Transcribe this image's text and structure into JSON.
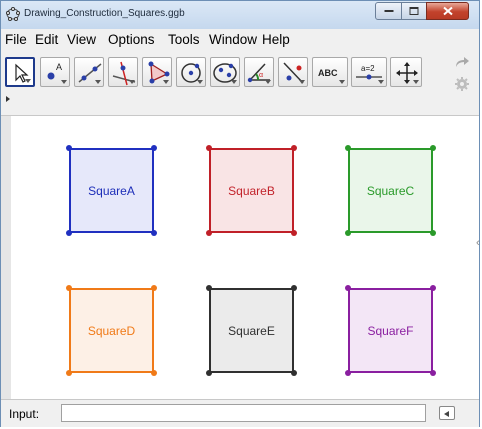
{
  "window": {
    "title": "Drawing_Construction_Squares.ggb"
  },
  "menu": [
    "File",
    "Edit",
    "View",
    "Options",
    "Tools",
    "Window",
    "Help"
  ],
  "toolbar": {
    "tools": [
      {
        "name": "move-tool",
        "icon": "arrow-icon"
      },
      {
        "name": "point-tool",
        "icon": "point-icon"
      },
      {
        "name": "line-tool",
        "icon": "line-icon"
      },
      {
        "name": "perpendicular-line-tool",
        "icon": "perpendicular-icon"
      },
      {
        "name": "polygon-tool",
        "icon": "polygon-icon"
      },
      {
        "name": "circle-tool",
        "icon": "circle-icon"
      },
      {
        "name": "ellipse-tool",
        "icon": "ellipse-icon"
      },
      {
        "name": "angle-tool",
        "icon": "angle-icon"
      },
      {
        "name": "reflect-tool",
        "icon": "reflect-icon"
      },
      {
        "name": "text-tool",
        "icon": "text-icon",
        "label": "ABC"
      },
      {
        "name": "slider-tool",
        "icon": "slider-icon",
        "label": "a=2"
      },
      {
        "name": "move-view-tool",
        "icon": "move-view-icon"
      }
    ]
  },
  "squares": [
    {
      "label": "SquareA",
      "color": "#2030c0",
      "fill": "#e6e8fa",
      "text": "#1c2db8"
    },
    {
      "label": "SquareB",
      "color": "#c02028",
      "fill": "#f9e4e5",
      "text": "#c2232b"
    },
    {
      "label": "SquareC",
      "color": "#2a9a2a",
      "fill": "#eaf6ea",
      "text": "#2a9a2a"
    },
    {
      "label": "SquareD",
      "color": "#f07a18",
      "fill": "#fdf0e6",
      "text": "#f07a18"
    },
    {
      "label": "SquareE",
      "color": "#303030",
      "fill": "#ebebeb",
      "text": "#303030"
    },
    {
      "label": "SquareF",
      "color": "#8a1fa0",
      "fill": "#f3e6f6",
      "text": "#8a1fa0"
    }
  ],
  "input": {
    "label": "Input:",
    "value": ""
  }
}
